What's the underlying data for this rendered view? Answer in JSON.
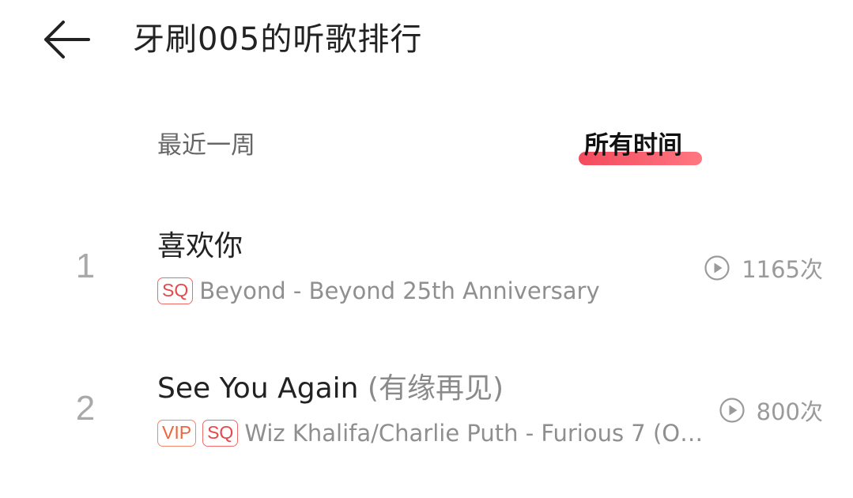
{
  "header": {
    "back_icon": "arrow-left-icon",
    "title": "牙刷005的听歌排行"
  },
  "tabs": [
    {
      "label": "最近一周",
      "active": false
    },
    {
      "label": "所有时间",
      "active": true
    }
  ],
  "accent_color": "#f23b4f",
  "songs": [
    {
      "rank": "1",
      "title": "喜欢你",
      "alias": "",
      "tags": [
        "SQ"
      ],
      "artist_album": "Beyond - Beyond 25th Anniversary",
      "plays": "1165次",
      "play_icon": "play-circle-icon"
    },
    {
      "rank": "2",
      "title": "See You Again",
      "alias": "(有缘再见)",
      "tags": [
        "VIP",
        "SQ"
      ],
      "artist_album": "Wiz Khalifa/Charlie Puth - Furious 7 (Ori…",
      "plays": "800次",
      "play_icon": "play-circle-icon"
    }
  ]
}
